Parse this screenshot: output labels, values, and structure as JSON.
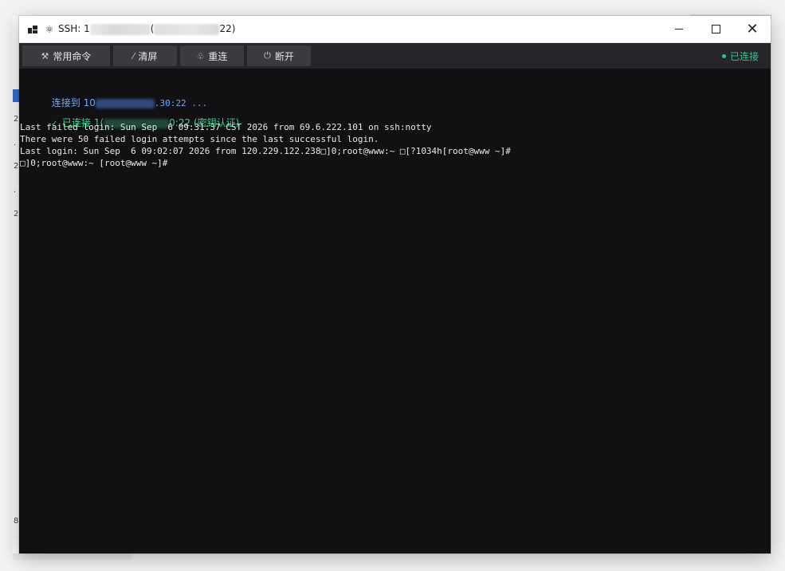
{
  "window": {
    "title_prefix": "SSH: 1",
    "title_suffix": "22)"
  },
  "titlebar_icons": {
    "app": "app-window-icon",
    "linux": "linux-penguin-icon"
  },
  "toolbar": {
    "buttons": [
      {
        "label": "常用命令",
        "icon": "tools-icon"
      },
      {
        "label": "清屏",
        "icon": "broom-icon"
      },
      {
        "label": "重连",
        "icon": "plug-icon"
      },
      {
        "label": "断开",
        "icon": "power-icon"
      }
    ],
    "status": "已连接",
    "status_color": "#2bc88a"
  },
  "terminal": {
    "connecting_prefix": "连接到 10",
    "connecting_suffix": ".30:22 ...",
    "connected_prefix": "已连接 1(",
    "connected_suffix": "0:22 (密钥认证)",
    "lines": [
      "Last failed login: Sun Sep  6 09:31:37 CST 2026 from 69.6.222.101 on ssh:notty",
      "There were 50 failed login attempts since the last successful login.",
      "Last login: Sun Sep  6 09:02:07 2026 from 120.229.122.238□]0;root@www:~ □[?1034h[root@www ~]#",
      "□]0;root@www:~ [root@www ~]#"
    ]
  },
  "background": {
    "glyphs": [
      "2",
      ".",
      "2",
      ".",
      "2",
      "8"
    ]
  },
  "colors": {
    "terminal_bg": "#111114",
    "toolbar_bg": "#26262a",
    "connecting": "#6aa9ff",
    "connected": "#3ad08a"
  }
}
